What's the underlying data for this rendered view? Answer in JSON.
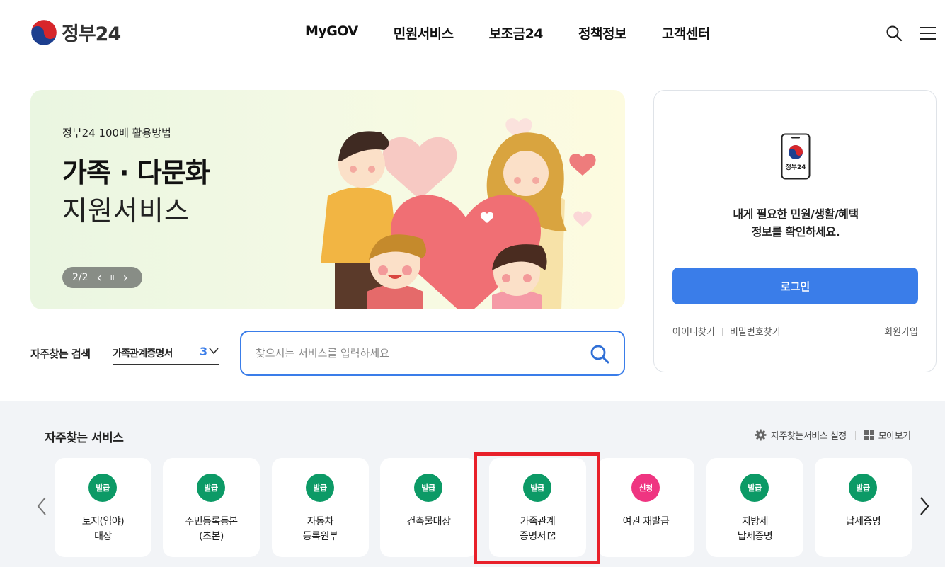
{
  "header": {
    "logo_text": "정부24",
    "nav": [
      "MyGOV",
      "민원서비스",
      "보조금24",
      "정책정보",
      "고객센터"
    ]
  },
  "banner": {
    "eyebrow": "정부24 100배 활용방법",
    "title": "가족 · 다문화",
    "subtitle": "지원서비스",
    "pager": "2/2",
    "prev_glyph": "‹",
    "pause_glyph": "II",
    "next_glyph": "›"
  },
  "login": {
    "phone_label": "정부24",
    "message_line1": "내게 필요한 민원/생활/혜택",
    "message_line2": "정보를 확인하세요.",
    "login_button": "로그인",
    "find_id": "아이디찾기",
    "find_password": "비밀번호찾기",
    "signup": "회원가입"
  },
  "search": {
    "frequent_label": "자주찾는 검색",
    "frequent_value": "가족관계증명서",
    "frequent_count": "3",
    "placeholder": "찾으시는 서비스를 입력하세요"
  },
  "services": {
    "title": "자주찾는 서비스",
    "settings_label": "자주찾는서비스 설정",
    "view_all_label": "모아보기",
    "cards": [
      {
        "badge": "발급",
        "badge_color": "#0c9a66",
        "line1": "토지(임야)",
        "line2": "대장"
      },
      {
        "badge": "발급",
        "badge_color": "#0c9a66",
        "line1": "주민등록등본",
        "line2": "(초본)"
      },
      {
        "badge": "발급",
        "badge_color": "#0c9a66",
        "line1": "자동차",
        "line2": "등록원부"
      },
      {
        "badge": "발급",
        "badge_color": "#0c9a66",
        "line1": "건축물대장",
        "line2": ""
      },
      {
        "badge": "발급",
        "badge_color": "#0c9a66",
        "line1": "가족관계",
        "line2": "증명서"
      },
      {
        "badge": "신청",
        "badge_color": "#ef3581",
        "line1": "여권 재발급",
        "line2": ""
      },
      {
        "badge": "발급",
        "badge_color": "#0c9a66",
        "line1": "지방세",
        "line2": "납세증명"
      },
      {
        "badge": "발급",
        "badge_color": "#0c9a66",
        "line1": "납세증명",
        "line2": ""
      }
    ]
  },
  "colors": {
    "primary_blue": "#3a7de9",
    "issue_green": "#0c9a66",
    "apply_pink": "#ef3581",
    "highlight_red": "#e8202a"
  }
}
